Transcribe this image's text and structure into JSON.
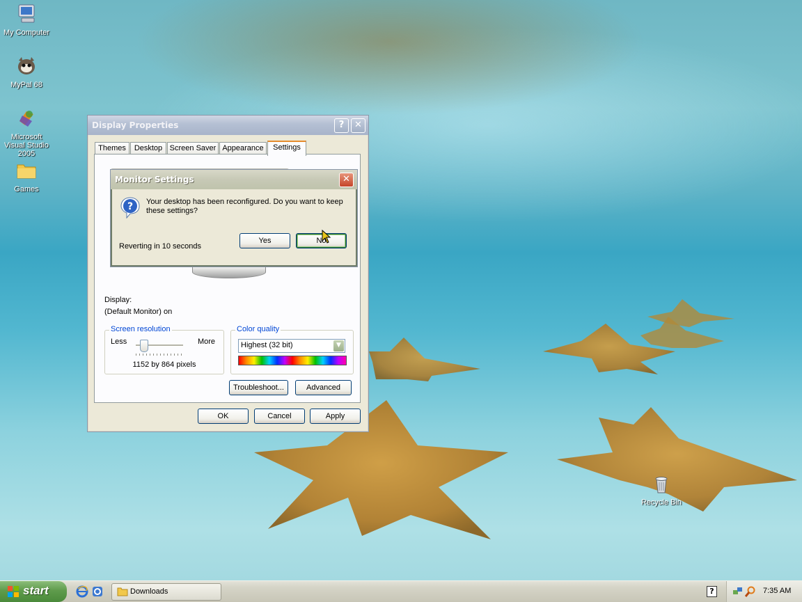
{
  "desktop": {
    "icons": [
      {
        "label": "My Computer",
        "icon": "my-computer-icon"
      },
      {
        "label": "MyPal 68",
        "icon": "mypal-icon"
      },
      {
        "label": "Microsoft Visual Studio 2005",
        "icon": "visual-studio-icon"
      },
      {
        "label": "Games",
        "icon": "folder-icon"
      },
      {
        "label": "Recycle Bin",
        "icon": "recycle-bin-icon"
      }
    ]
  },
  "display_properties": {
    "title": "Display Properties",
    "help_label": "?",
    "close_label": "✕",
    "tabs": [
      "Themes",
      "Desktop",
      "Screen Saver",
      "Appearance",
      "Settings"
    ],
    "active_tab": "Settings",
    "display_label": "Display:",
    "display_value": "(Default Monitor) on",
    "resolution": {
      "legend": "Screen resolution",
      "less": "Less",
      "more": "More",
      "value": "1152 by 864 pixels"
    },
    "color_quality": {
      "legend": "Color quality",
      "selected": "Highest (32 bit)"
    },
    "troubleshoot_label": "Troubleshoot...",
    "advanced_label": "Advanced",
    "ok_label": "OK",
    "cancel_label": "Cancel",
    "apply_label": "Apply"
  },
  "monitor_settings": {
    "title": "Monitor Settings",
    "close_label": "✕",
    "message": "Your desktop has been reconfigured.  Do you want to keep these settings?",
    "countdown": "Reverting in 10 seconds",
    "yes_label": "Yes",
    "no_label": "No"
  },
  "taskbar": {
    "start_label": "start",
    "task_label": "Downloads",
    "clock": "7:35 AM",
    "help_label": "?"
  },
  "colors": {
    "xp_orange": "#e68b2c",
    "button_border": "#003c74",
    "legend_blue": "#0046d5",
    "start_green": "#5f9b4c"
  }
}
